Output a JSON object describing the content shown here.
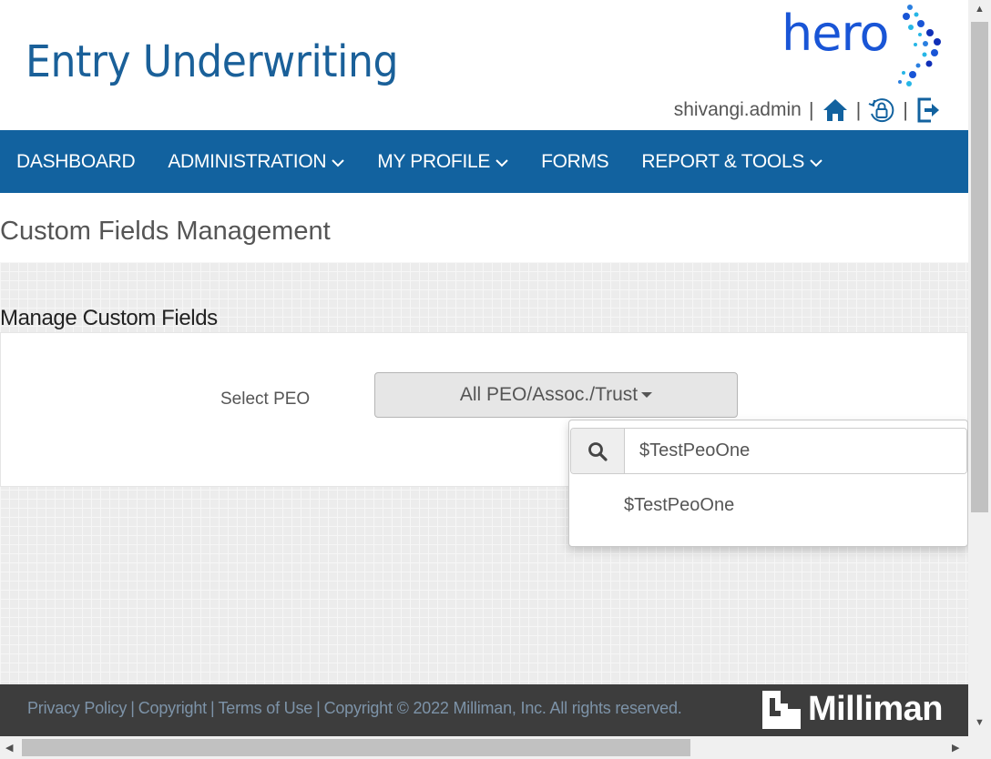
{
  "header": {
    "app_title": "Entry Underwriting",
    "logo_text": "hero",
    "username": "shivangi.admin",
    "sep": "|"
  },
  "nav": {
    "items": [
      {
        "label": "DASHBOARD",
        "has_dropdown": false
      },
      {
        "label": "ADMINISTRATION",
        "has_dropdown": true
      },
      {
        "label": "MY PROFILE",
        "has_dropdown": true
      },
      {
        "label": "FORMS",
        "has_dropdown": false
      },
      {
        "label": "REPORT & TOOLS",
        "has_dropdown": true
      }
    ]
  },
  "page": {
    "heading": "Custom Fields Management",
    "section_title": "Manage Custom Fields",
    "select_label": "Select PEO",
    "select_value": "All PEO/Assoc./Trust"
  },
  "dropdown": {
    "search_value": "$TestPeoOne",
    "options": [
      "$TestPeoOne"
    ]
  },
  "footer": {
    "links": [
      "Privacy Policy",
      "Copyright",
      "Terms of Use"
    ],
    "copyright": "Copyright © 2022 Milliman, Inc. All rights reserved.",
    "brand": "Milliman",
    "sep": "|"
  },
  "colors": {
    "nav_bg": "#12629f",
    "title": "#1a6099",
    "logo": "#1955d6",
    "footer_bg": "#3d3d3d"
  },
  "icons": {
    "home": "home-icon",
    "lock": "lock-icon",
    "logout": "logout-icon",
    "search": "search-icon",
    "caret": "caret-down-icon",
    "chevron": "chevron-down-icon"
  }
}
